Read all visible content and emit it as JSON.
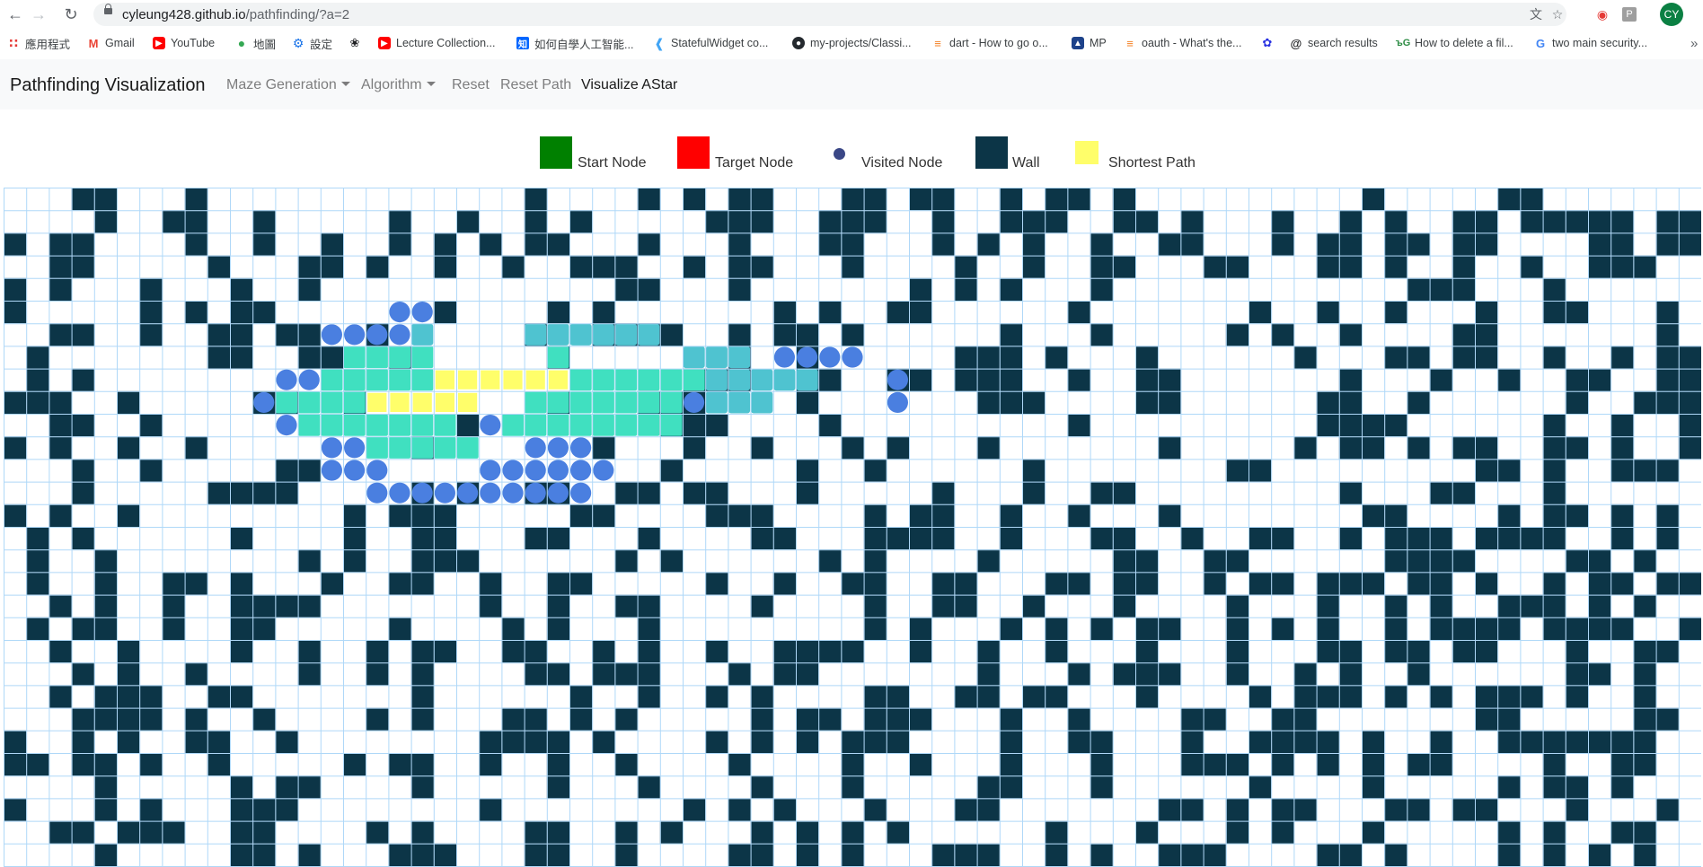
{
  "browser": {
    "url_host": "cyleung428.github.io",
    "url_path": "/pathfinding/?a=2",
    "avatar_initials": "CY",
    "bookmarks": [
      {
        "label": "應用程式",
        "icon": "apps-grid-icon"
      },
      {
        "label": "Gmail",
        "icon": "gmail-icon"
      },
      {
        "label": "YouTube",
        "icon": "youtube-icon"
      },
      {
        "label": "地圖",
        "icon": "maps-pin-icon"
      },
      {
        "label": "設定",
        "icon": "settings-gear-icon"
      },
      {
        "label": "",
        "icon": "openai-icon"
      },
      {
        "label": "Lecture Collection...",
        "icon": "youtube-icon"
      },
      {
        "label": "如何自學人工智能...",
        "icon": "zhihu-icon"
      },
      {
        "label": "StatefulWidget co...",
        "icon": "flutter-icon"
      },
      {
        "label": "my-projects/Classi...",
        "icon": "github-icon"
      },
      {
        "label": "dart - How to go o...",
        "icon": "stackoverflow-icon"
      },
      {
        "label": "MP",
        "icon": "nba-icon"
      },
      {
        "label": "oauth - What's the...",
        "icon": "stackoverflow-icon"
      },
      {
        "label": "",
        "icon": "paw-icon"
      },
      {
        "label": "search results",
        "icon": "at-sign-icon"
      },
      {
        "label": "How to delete a fil...",
        "icon": "geeksforgeeks-icon"
      },
      {
        "label": "two main security...",
        "icon": "google-icon"
      }
    ]
  },
  "navbar": {
    "brand": "Pathfinding Visualization",
    "maze_generation": "Maze Generation",
    "algorithm": "Algorithm",
    "reset": "Reset",
    "reset_path": "Reset Path",
    "visualize": "Visualize AStar"
  },
  "legend": {
    "start": "Start Node",
    "target": "Target Node",
    "visited": "Visited Node",
    "wall": "Wall",
    "shortest": "Shortest Path"
  },
  "colors": {
    "start": "#008000",
    "target": "#ff0000",
    "visited_dot": "#3a4786",
    "wall": "#0c3547",
    "shortest": "#fffe6a",
    "visited_teal": "#40e0c0",
    "visited_cyan": "#4fc3d0",
    "frontier_blue": "#4a7fe0",
    "grid_line": "#afd8f8"
  },
  "grid": {
    "cols": 75,
    "rows": 30,
    "walls": [
      "...XX...X..............X....X.X.XX...XX.XX..X.XX.X..........X.....XX.......",
      "....X..XX..X.....X..X..X.X.....XXX..XXX..X..XXX..XX.X...X..X.X..XX.XXXXX.XX",
      "X.XX....X..X..X..X.X.X.XX...X...X...XX...X.X.X..X..XX...X.XX.XX.XX....XX.XX",
      "..XX.....X...XX.X..X..X..XXX..X.XX...X....X..X..XX...XX...XX.X..X..X..XXX..",
      "X.X...X...X..X.............XX...X.......X.X.X...X.............XXX...X......",
      "X.....X.X.XX.......X....X.X.......X.X..XX......X.......X..X..X...X..XX...X.",
      "..XX..X..XX.XX..X......X..XXXX..X.XX.X......X...X.....X.X..X....XX.......X.",
      ".X.......XX..XX..X......X.......X..X......XXX.X...X......X...XX.XX..X..X.XX",
      ".X.X..........................XXX..XX..XX.XXX..X..XX.......X...X..X..XX..XX",
      "XXX..X.....XX..X........X...XXX....X.......XXX....XX......XX..X......X..XXX",
      "..XX..X.............X........XXX....X..........X..........XXXX......X..X..X",
      "X.X..X..X.........X.......X...X..X...X.X...X.......X.....X.XX.X.XX..XX.X..X",
      "...X..X.....XX...............X.....X..X......X........XX.........XX.X..XXX.",
      "...X.....XXXX.....X.X..XX..XX.XX...X.....X...X..XX.........X...XX...X......",
      "X.X..X.........X.XXX.....XX....XXX....X.XX..X..X...X........XX....X.XX.X.X.",
      ".X.X......X....X..XX...XX...X....XX...XXXX..X...XX..X..XX..X.XXX.XXXX..X.X.",
      ".X..X........X.X..XXX......X.X......X.X....X.....XX..XX......XXXX....XX.X..",
      ".X..X..XX.X...X..XX..X..XX.....X..X..XX..XX...XX.XX..X.XX.XXX.XX.X..X.XX.XX",
      "..X.X..X..XXXX.......X..X..XX....X....X..XX..X...X....X...X..X.X..XXX.X.X...",
      ".X.XX..X..XX.....X....X.X...X.........X.X...X.X.X.XX..X.X.X..X.XXXX.XXXX..X",
      "..X..X....X..X..X.XX..XX..X.X..X..XXXX..X..X..X...X...X...XX.XX.XX...X..XX.",
      "...X.X..X....X..X.X....XX.XXX...X.XX.......X...X.XXX..X..X.X..X......XX.X..",
      "..X.XXX..XX.......X......X..X..X.X....XX..XX.XX...X....X.XXX.X.X.XXX.X..X..",
      "...XXXX.X..X....X.X...XX.X.X.....X.XX.XXX...X..X....XX..XX.......XX.....XX.",
      "X..X.X..XX..X........XXXX.X....X.X.X.XXX....X..XX...X..XXXX.X..X..XXXXXXX..",
      "XX.XX.X..X.....X.XX..X..X..X....X....X..X...X...X...XXX.X.X.X.XX....X..XX..",
      "....X.....X.XX....X.....X...X....X...X.....XX...X......X....X.....X.XX.X...",
      "X...X.X...XXX........X........X.X.X...X...XX.......XX.X.XX...XX.XX...X...X.",
      "..XX.XXX..XX....X.X....XX..X.X...X.X.X.X......X...X...X.X...X.....X.X..XX..",
      "....X.....XX.X...XXX...XX..X....XX.X.X...XXX..X.X..XXX....XX.X....X.X.X.X.."
    ],
    "cells": [
      "................................................",
      "................................................",
      "................................................",
      "................................................",
      "................................................",
      ".................OO.............................",
      "..............OOOOC....CCCCCC...................",
      "...............TTTT.....T.....CCC.OOOO..........",
      "............OOTTTTTYYYYYYTTTTTTCCCCC...O.........",
      "...........OTTTTYYYYY..TTTTTTTOCCC.....O.........",
      "............OTTTTTTT.OTTTTTTTT...................",
      "..............OOTTTTT..OOO.......................",
      "..............OOO....OOOOOO......................",
      "................OOOOOOOOOO.......................",
      "................................................"
    ],
    "cells_legend": {
      "O": "frontier-node",
      "T": "visited-node",
      "C": "visited-cyan-node",
      "Y": "shortest-path-node"
    }
  }
}
